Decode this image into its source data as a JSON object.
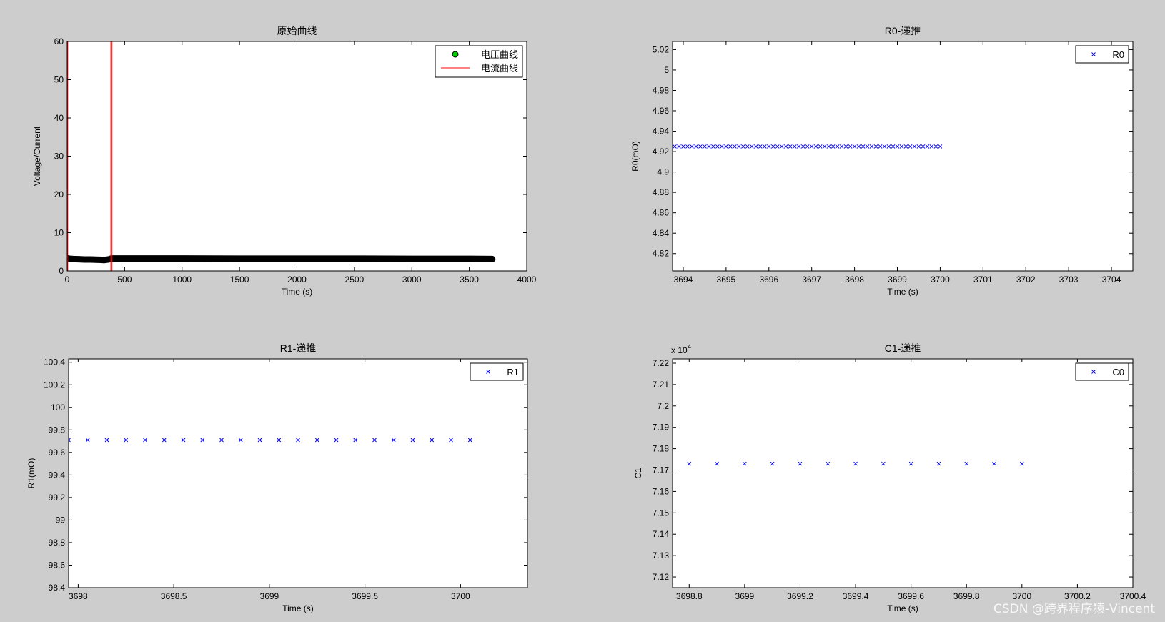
{
  "colors": {
    "figure_bg": "#cdcdcd",
    "axes_bg": "#ffffff",
    "axis_line": "#000000",
    "voltage_marker_fill": "#00cc00",
    "voltage_trace": "#000000",
    "current_line": "#ff0000",
    "estimate_marker": "#0000ff"
  },
  "watermark": "CSDN @跨界程序猿-Vincent",
  "chart_data": [
    {
      "id": "raw",
      "type": "line",
      "title": "原始曲线",
      "xlabel": "Time (s)",
      "ylabel": "Voltage/Current",
      "xlim": [
        0,
        4000
      ],
      "ylim": [
        0,
        60
      ],
      "xticks": [
        0,
        500,
        1000,
        1500,
        2000,
        2500,
        3000,
        3500,
        4000
      ],
      "yticks": [
        0,
        10,
        20,
        30,
        40,
        50,
        60
      ],
      "legend_position": "top-right",
      "series": [
        {
          "name": "电压曲线",
          "style": "marker-line",
          "marker": "circle",
          "color": "#000000",
          "marker_color": "#00cc00",
          "x": [
            0,
            10,
            50,
            100,
            150,
            200,
            250,
            300,
            320,
            360,
            380,
            400,
            600,
            1000,
            1500,
            2000,
            2500,
            3000,
            3500,
            3700
          ],
          "y": [
            3.4,
            3.2,
            3.1,
            3.05,
            3.0,
            3.0,
            2.95,
            2.9,
            2.85,
            3.0,
            3.2,
            3.25,
            3.25,
            3.25,
            3.2,
            3.2,
            3.2,
            3.15,
            3.15,
            3.1
          ]
        },
        {
          "name": "电流曲线",
          "style": "line",
          "color": "#ff0000",
          "x": [
            0,
            0,
            5,
            5,
            380,
            380,
            390,
            390,
            3700
          ],
          "y": [
            0,
            60,
            60,
            0,
            0,
            60,
            60,
            0,
            0
          ]
        }
      ]
    },
    {
      "id": "r0",
      "type": "scatter",
      "title": "R0-递推",
      "xlabel": "Time (s)",
      "ylabel": "R0(mO)",
      "xlim": [
        3693.75,
        3704.5
      ],
      "ylim": [
        4.803,
        5.028
      ],
      "xticks": [
        3694,
        3695,
        3696,
        3697,
        3698,
        3699,
        3700,
        3701,
        3702,
        3703,
        3704
      ],
      "yticks": [
        4.82,
        4.84,
        4.86,
        4.88,
        4.9,
        4.92,
        4.94,
        4.96,
        4.98,
        5,
        5.02
      ],
      "legend_position": "top-right",
      "series": [
        {
          "name": "R0",
          "marker": "x",
          "color": "#0000ff",
          "x_range": [
            3693.8,
            3700.0,
            0.1
          ],
          "y_const": 4.925
        }
      ]
    },
    {
      "id": "r1",
      "type": "scatter",
      "title": "R1-递推",
      "xlabel": "Time (s)",
      "ylabel": "R1(mO)",
      "xlim": [
        3697.95,
        3700.35
      ],
      "ylim": [
        98.4,
        100.43
      ],
      "xticks": [
        3698,
        3698.5,
        3699,
        3699.5,
        3700
      ],
      "xtick_labels": [
        "3698",
        "3698.5",
        "3699",
        "3699.5",
        "3700"
      ],
      "yticks": [
        98.4,
        98.6,
        98.8,
        99,
        99.2,
        99.4,
        99.6,
        99.8,
        100,
        100.2,
        100.4
      ],
      "legend_position": "top-right",
      "series": [
        {
          "name": "R1",
          "marker": "x",
          "color": "#0000ff",
          "x_range": [
            3697.95,
            3700.0,
            0.1
          ],
          "y_const": 99.71
        }
      ]
    },
    {
      "id": "c1",
      "type": "scatter",
      "title": "C1-递推",
      "xlabel": "Time (s)",
      "ylabel": "C1",
      "y_exponent_label": "x 10",
      "y_exponent": "4",
      "xlim": [
        3698.74,
        3700.4
      ],
      "ylim": [
        7.115,
        7.222
      ],
      "xticks": [
        3698.8,
        3699,
        3699.2,
        3699.4,
        3699.6,
        3699.8,
        3700,
        3700.2,
        3700.4
      ],
      "xtick_labels": [
        "3698.8",
        "3699",
        "3699.2",
        "3699.4",
        "3699.6",
        "3699.8",
        "3700",
        "3700.2",
        "3700.4"
      ],
      "yticks": [
        7.12,
        7.13,
        7.14,
        7.15,
        7.16,
        7.17,
        7.18,
        7.19,
        7.2,
        7.21,
        7.22
      ],
      "legend_position": "top-right",
      "series": [
        {
          "name": "C0",
          "marker": "x",
          "color": "#0000ff",
          "x_range": [
            3698.8,
            3700.0,
            0.1
          ],
          "y_const": 7.173
        }
      ]
    }
  ]
}
